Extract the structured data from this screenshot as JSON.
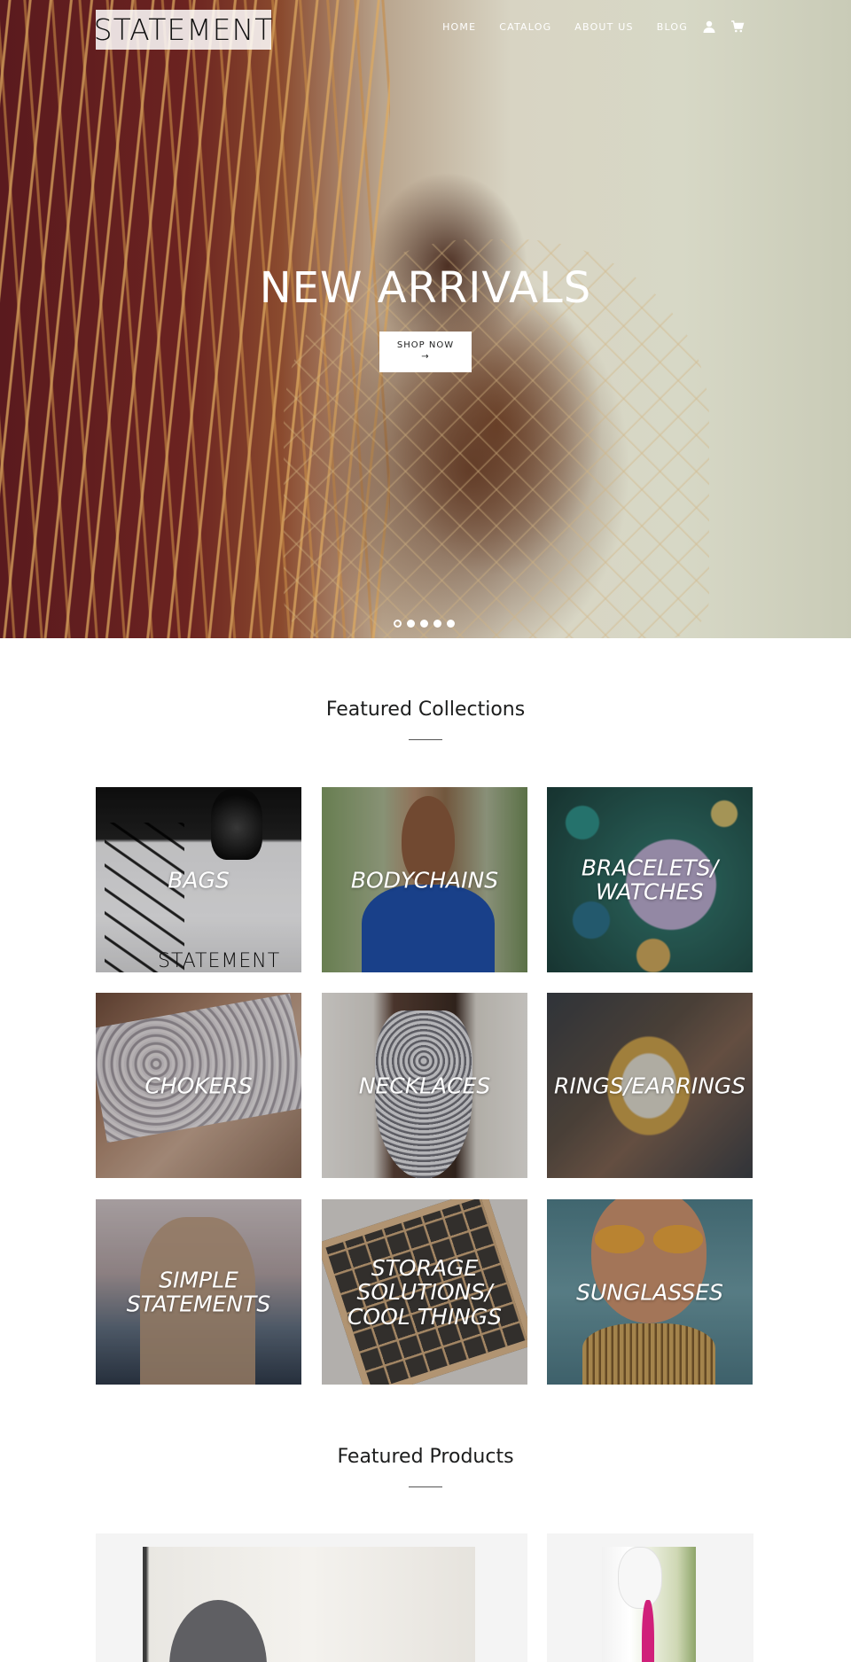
{
  "header": {
    "logo_text": "STATEMENT",
    "nav": [
      "HOME",
      "CATALOG",
      "ABOUT US",
      "BLOG"
    ],
    "icons": [
      "account-icon",
      "cart-icon"
    ]
  },
  "hero": {
    "title": "NEW ARRIVALS",
    "button_label": "SHOP NOW",
    "button_arrow": "→",
    "slides_count": 5,
    "active_slide": 1
  },
  "featured_collections": {
    "title": "Featured Collections",
    "items": [
      {
        "label": "BAGS"
      },
      {
        "label": "BODYCHAINS"
      },
      {
        "label": "BRACELETS/ WATCHES"
      },
      {
        "label": "CHOKERS"
      },
      {
        "label": "NECKLACES"
      },
      {
        "label": "RINGS/EARRINGS"
      },
      {
        "label": "SIMPLE STATEMENTS"
      },
      {
        "label": "STORAGE SOLUTIONS/ COOL THINGS"
      },
      {
        "label": "SUNGLASSES"
      }
    ]
  },
  "featured_products": {
    "title": "Featured Products"
  },
  "colors": {
    "text": "#1c1d1d",
    "hero_text": "#ffffff",
    "product_bg": "#f4f4f4"
  }
}
